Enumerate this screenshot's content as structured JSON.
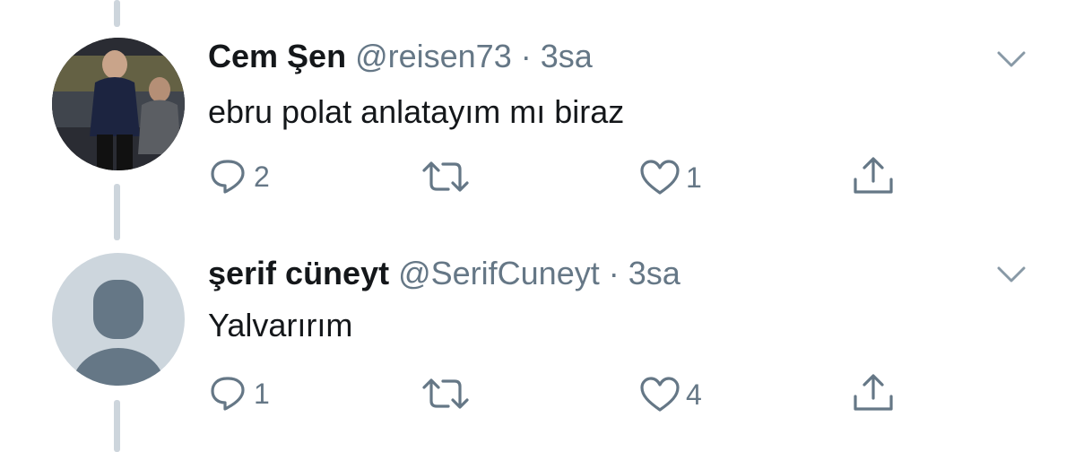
{
  "tweets": [
    {
      "name": "Cem Şen",
      "handle": "@reisen73",
      "separator": "·",
      "time": "3sa",
      "text": "ebru polat anlatayım mı biraz",
      "reply_count": "2",
      "retweet_count": "",
      "like_count": "1",
      "avatar": "photo"
    },
    {
      "name": "şerif cüneyt",
      "handle": "@SerifCuneyt",
      "separator": "·",
      "time": "3sa",
      "text": "Yalvarırım",
      "reply_count": "1",
      "retweet_count": "",
      "like_count": "4",
      "avatar": "default-egg"
    }
  ],
  "icons": {
    "reply": "reply-icon",
    "retweet": "retweet-icon",
    "like": "heart-icon",
    "share": "share-icon",
    "menu": "chevron-down-icon"
  },
  "colors": {
    "text": "#14171a",
    "secondary": "#657786",
    "thread_line": "#cdd5dc",
    "default_avatar_bg": "#cdd6dd",
    "default_avatar_fg": "#657786"
  }
}
